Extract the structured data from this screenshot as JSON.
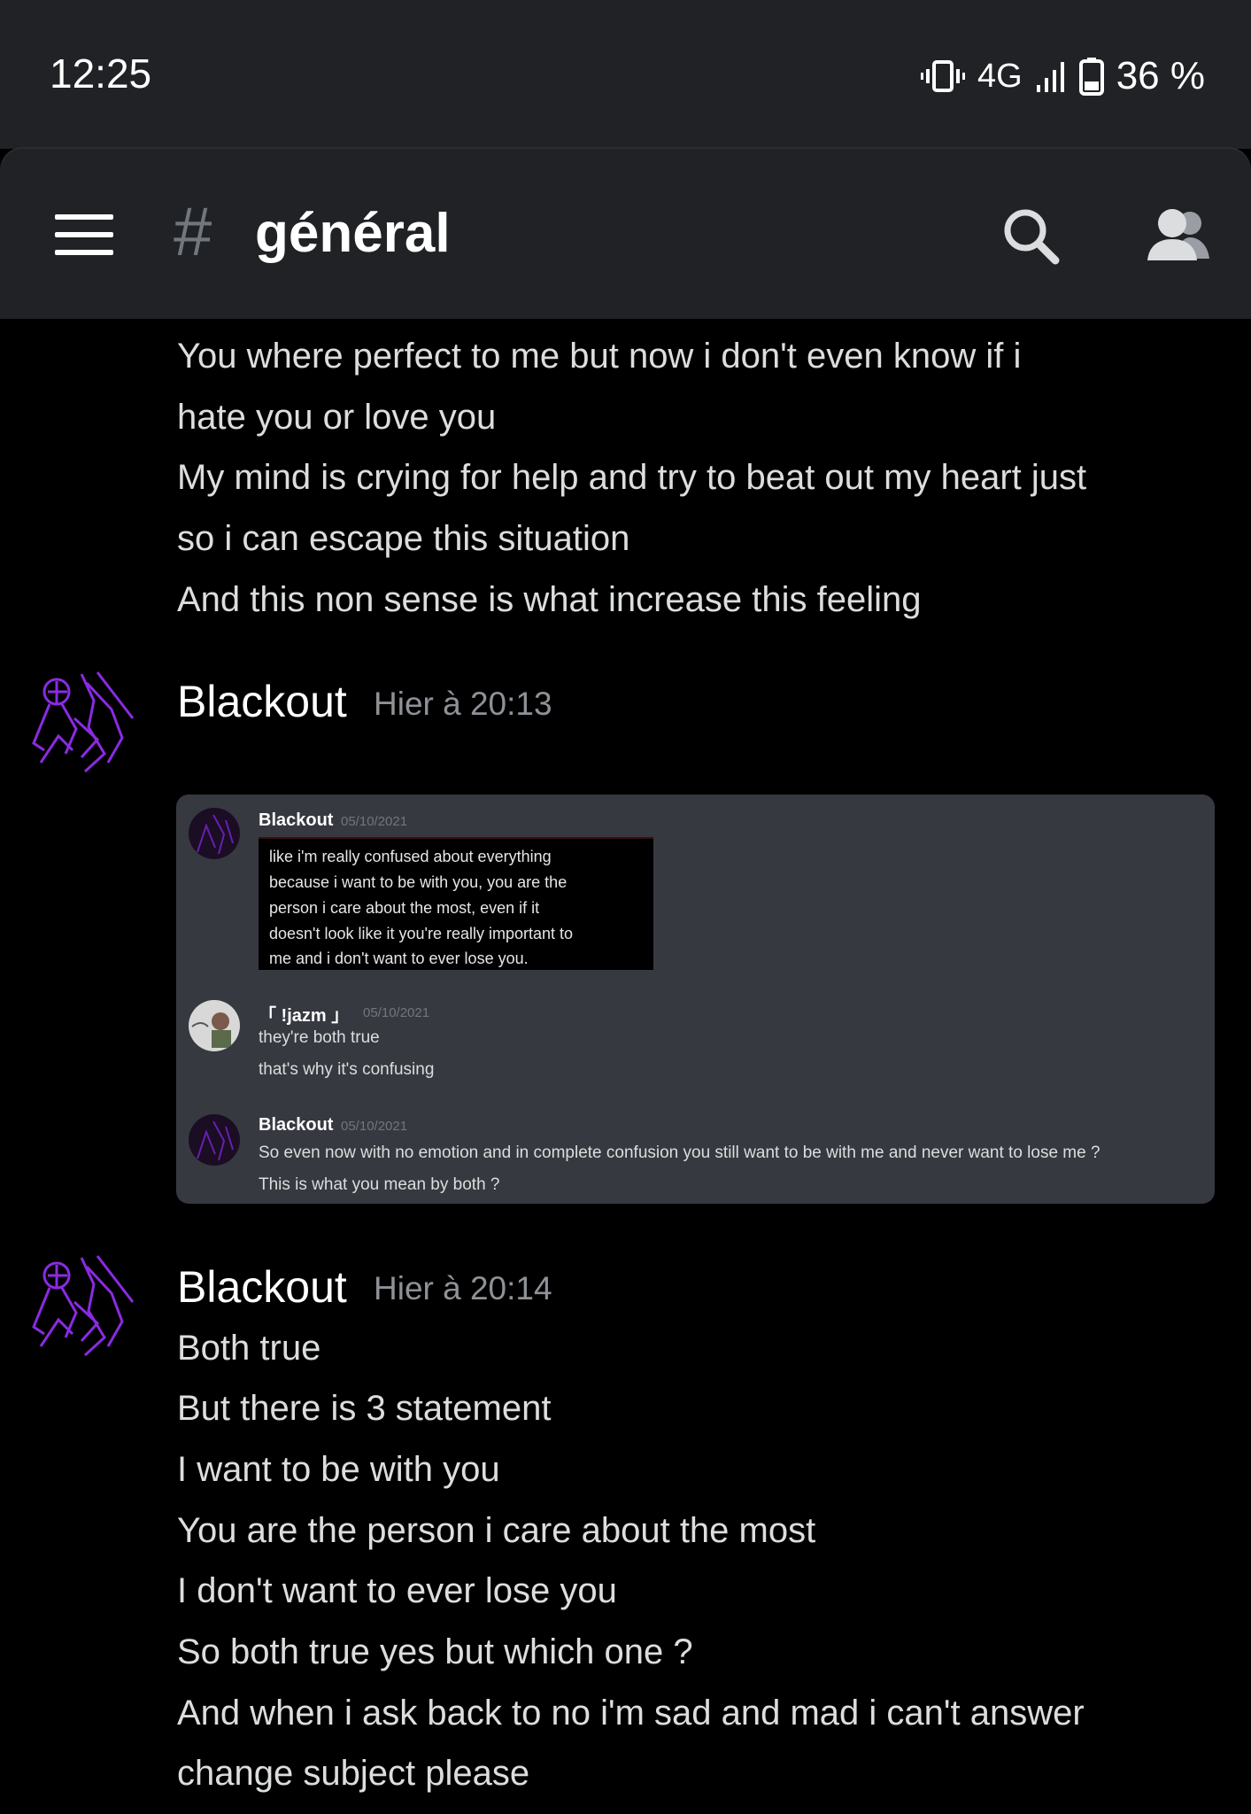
{
  "status_bar": {
    "time": "12:25",
    "network": "4G",
    "battery": "36 %"
  },
  "header": {
    "hash": "#",
    "channel": "général"
  },
  "messages": {
    "continued_lines": [
      "You where perfect to me but now i don't even know if i",
      "hate you or love you",
      "My mind is crying for help and try to beat out my heart just",
      "so i can escape this situation",
      "And this non sense is what increase this feeling"
    ],
    "msg1": {
      "author": "Blackout",
      "timestamp": "Hier à 20:13"
    },
    "embed": {
      "m1": {
        "author": "Blackout",
        "date": "05/10/2021",
        "lines": [
          "like i'm really confused about everything",
          "because i want to be with you, you are the",
          "person i care about the most, even if it",
          "doesn't look like it you're really important to",
          "me and i don't want to ever lose you."
        ]
      },
      "m2": {
        "author": "「 !jazm 」",
        "date": "05/10/2021",
        "lines": [
          "they're both true",
          "that's why it's confusing"
        ]
      },
      "m3": {
        "author": "Blackout",
        "date": "05/10/2021",
        "lines": [
          "So even now with no emotion and in complete confusion you still want to be with me and never want to lose me ?",
          "This is what you mean by both ?"
        ]
      }
    },
    "msg2": {
      "author": "Blackout",
      "timestamp": "Hier à 20:14",
      "lines": [
        "Both true",
        "But there is 3 statement",
        "I want to be with you",
        "You are the person i care about the most",
        "I don't want to ever lose you",
        "So both true yes but which one ?",
        "And when i ask back to no i'm sad and mad i can't answer",
        "change subject please"
      ]
    }
  },
  "colors": {
    "background": "#000000",
    "header_bg": "#202225",
    "embed_bg": "#36393f",
    "avatar_accent": "#8a2be2",
    "timestamp": "#8e9297"
  },
  "icons": [
    "vibrate-icon",
    "signal-icon",
    "battery-icon",
    "menu-icon",
    "search-icon",
    "members-icon",
    "avatar-icon"
  ]
}
